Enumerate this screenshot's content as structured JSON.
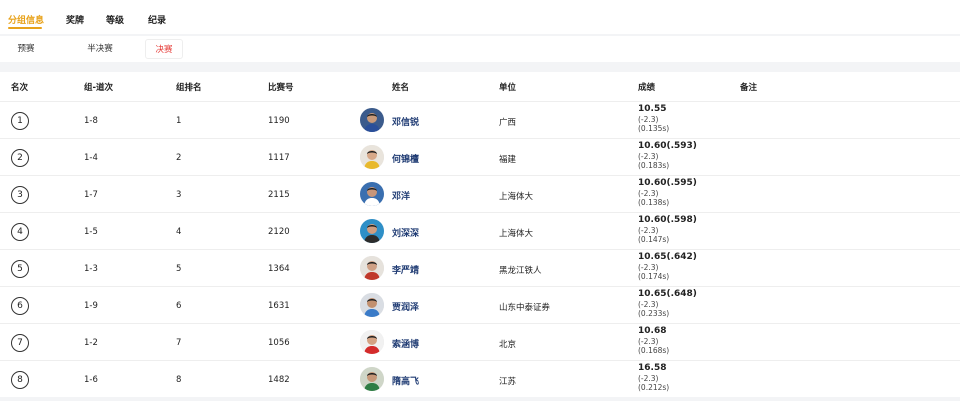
{
  "tabs": [
    {
      "label": "分组信息",
      "active": true
    },
    {
      "label": "奖牌",
      "active": false
    },
    {
      "label": "等级",
      "active": false
    },
    {
      "label": "纪录",
      "active": false
    }
  ],
  "rounds": [
    {
      "label": "预赛",
      "active": false
    },
    {
      "label": "半决赛",
      "active": false
    },
    {
      "label": "决赛",
      "active": true
    }
  ],
  "columns": [
    "名次",
    "组-道次",
    "组排名",
    "比赛号",
    "姓名",
    "单位",
    "成绩",
    "备注"
  ],
  "rows": [
    {
      "rank": "1",
      "lane": "1-8",
      "group_rank": "1",
      "bib": "1190",
      "name": "邓信锐",
      "unit": "广西",
      "result": "10.55",
      "wind": "(-2.3)",
      "reaction": "(0.135s)",
      "remark": ""
    },
    {
      "rank": "2",
      "lane": "1-4",
      "group_rank": "2",
      "bib": "1117",
      "name": "何锦檀",
      "unit": "福建",
      "result": "10.60(.593)",
      "wind": "(-2.3)",
      "reaction": "(0.183s)",
      "remark": ""
    },
    {
      "rank": "3",
      "lane": "1-7",
      "group_rank": "3",
      "bib": "2115",
      "name": "邓洋",
      "unit": "上海体大",
      "result": "10.60(.595)",
      "wind": "(-2.3)",
      "reaction": "(0.138s)",
      "remark": ""
    },
    {
      "rank": "4",
      "lane": "1-5",
      "group_rank": "4",
      "bib": "2120",
      "name": "刘深深",
      "unit": "上海体大",
      "result": "10.60(.598)",
      "wind": "(-2.3)",
      "reaction": "(0.147s)",
      "remark": ""
    },
    {
      "rank": "5",
      "lane": "1-3",
      "group_rank": "5",
      "bib": "1364",
      "name": "李严靖",
      "unit": "黑龙江铁人",
      "result": "10.65(.642)",
      "wind": "(-2.3)",
      "reaction": "(0.174s)",
      "remark": ""
    },
    {
      "rank": "6",
      "lane": "1-9",
      "group_rank": "6",
      "bib": "1631",
      "name": "贾润泽",
      "unit": "山东中泰证券",
      "result": "10.65(.648)",
      "wind": "(-2.3)",
      "reaction": "(0.233s)",
      "remark": ""
    },
    {
      "rank": "7",
      "lane": "1-2",
      "group_rank": "7",
      "bib": "1056",
      "name": "索涵博",
      "unit": "北京",
      "result": "10.68",
      "wind": "(-2.3)",
      "reaction": "(0.168s)",
      "remark": ""
    },
    {
      "rank": "8",
      "lane": "1-6",
      "group_rank": "8",
      "bib": "1482",
      "name": "隋高飞",
      "unit": "江苏",
      "result": "16.58",
      "wind": "(-2.3)",
      "reaction": "(0.212s)",
      "remark": ""
    }
  ],
  "avatars": [
    {
      "bg": "#3b5b8c",
      "skin": "#c99a7a",
      "shirt": "#2a4f9a"
    },
    {
      "bg": "#e9e4dc",
      "skin": "#d8a989",
      "shirt": "#e8b92c"
    },
    {
      "bg": "#3a6fb0",
      "skin": "#c8967a",
      "shirt": "#ffffff"
    },
    {
      "bg": "#2e8fc7",
      "skin": "#cf9d80",
      "shirt": "#2c2c2c"
    },
    {
      "bg": "#e6e2dc",
      "skin": "#cfa085",
      "shirt": "#c0392b"
    },
    {
      "bg": "#d9dde3",
      "skin": "#c2906f",
      "shirt": "#3a7bc8"
    },
    {
      "bg": "#f1f1f1",
      "skin": "#d4a283",
      "shirt": "#d42b2b"
    },
    {
      "bg": "#cfd6c8",
      "skin": "#c69778",
      "shirt": "#2f7d45"
    }
  ]
}
